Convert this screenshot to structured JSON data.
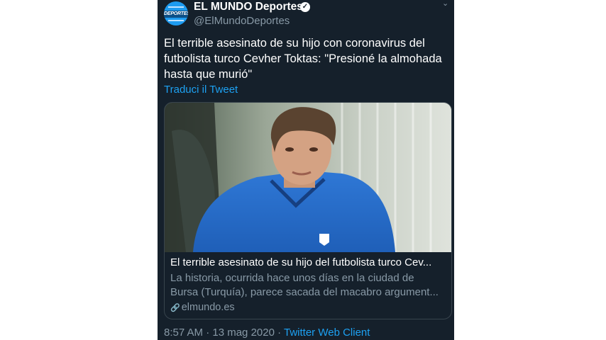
{
  "account": {
    "name": "EL MUNDO Deportes",
    "handle": "@ElMundoDeportes",
    "avatar_text": "DEPORTES"
  },
  "tweet": {
    "text": "El terrible asesinato de su hijo con coronavirus del futbolista turco Cevher Toktas: \"Presioné la almohada hasta que murió\"",
    "translate_label": "Traduci il Tweet",
    "timestamp": "8:57 AM · 13 mag 2020 · ",
    "client": "Twitter Web Client"
  },
  "card": {
    "title": "El terrible asesinato de su hijo del futbolista turco Cev...",
    "description_line1": "La historia, ocurrida hace unos días en la ciudad de",
    "description_line2": "Bursa (Turquía), parece sacada del macabro argument...",
    "domain": "elmundo.es"
  },
  "colors": {
    "background": "#15202b",
    "accent": "#1da1f2",
    "secondary_text": "#8899a6",
    "border": "#38444d"
  },
  "icons": [
    "verified-badge-icon",
    "chevron-down-icon",
    "link-icon"
  ]
}
